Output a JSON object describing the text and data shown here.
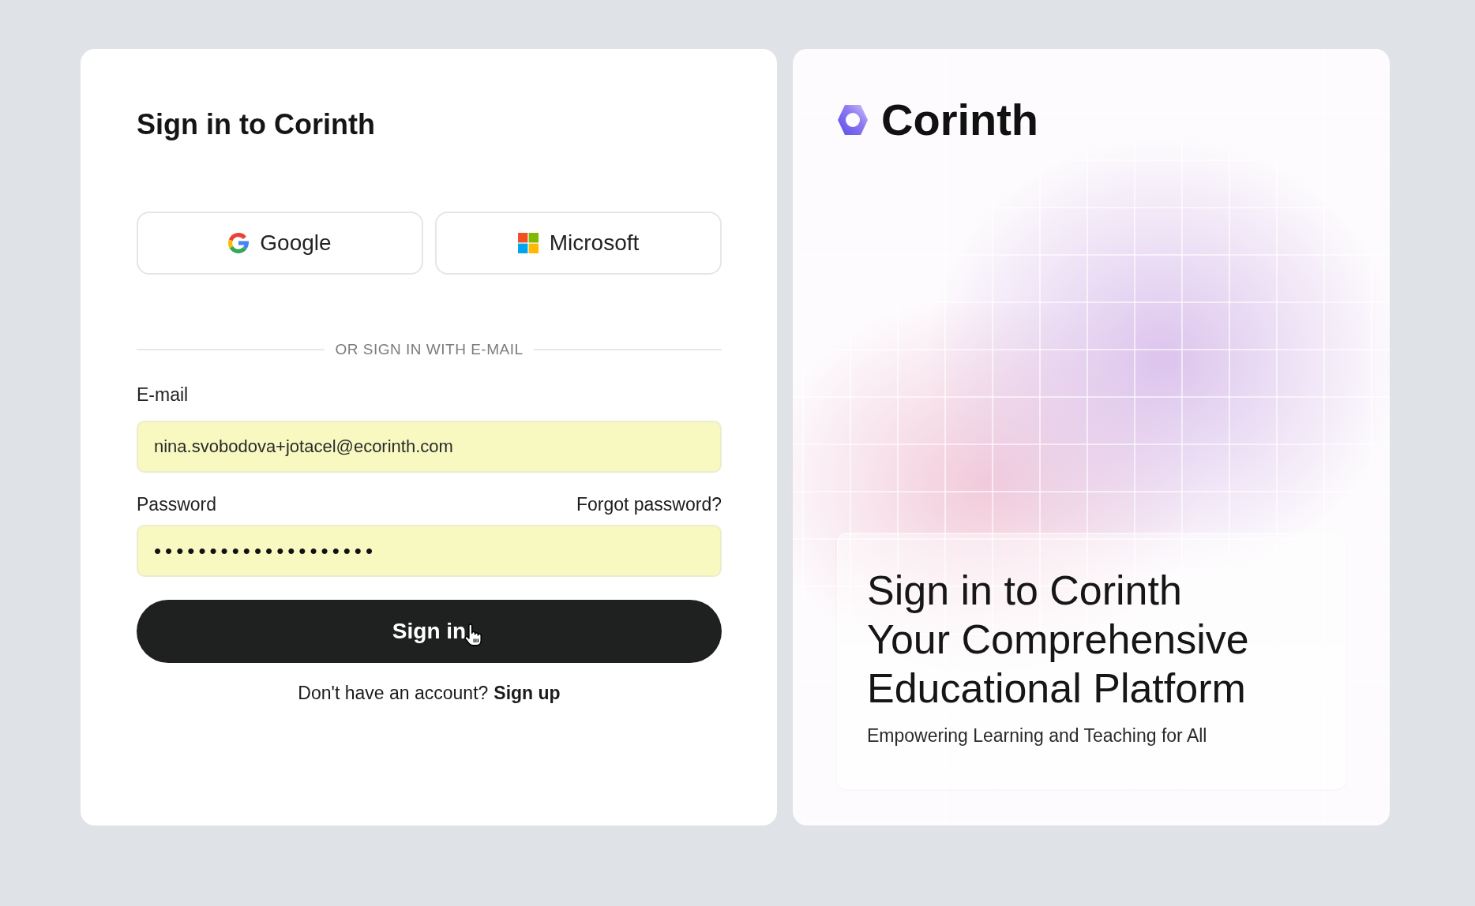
{
  "login": {
    "title": "Sign in to Corinth",
    "social_buttons": [
      {
        "kind": "google",
        "label": "Google"
      },
      {
        "kind": "microsoft",
        "label": "Microsoft"
      }
    ],
    "divider": "OR SIGN IN WITH E-MAIL",
    "email": {
      "label": "E-mail",
      "value": "nina.svobodova+jotacel@ecorinth.com"
    },
    "password": {
      "label": "Password",
      "link": "Forgot password?",
      "value": "••••••••••••••••••••"
    },
    "submit_button": "Sign in",
    "signup": {
      "prompt": "Don't have an account?",
      "link": "Sign up"
    }
  },
  "brand": {
    "name": "Corinth",
    "headline": [
      "Sign in to Corinth",
      "Your Comprehensive",
      "Educational Platform"
    ],
    "tagline": "Empowering Learning and Teaching for All"
  }
}
